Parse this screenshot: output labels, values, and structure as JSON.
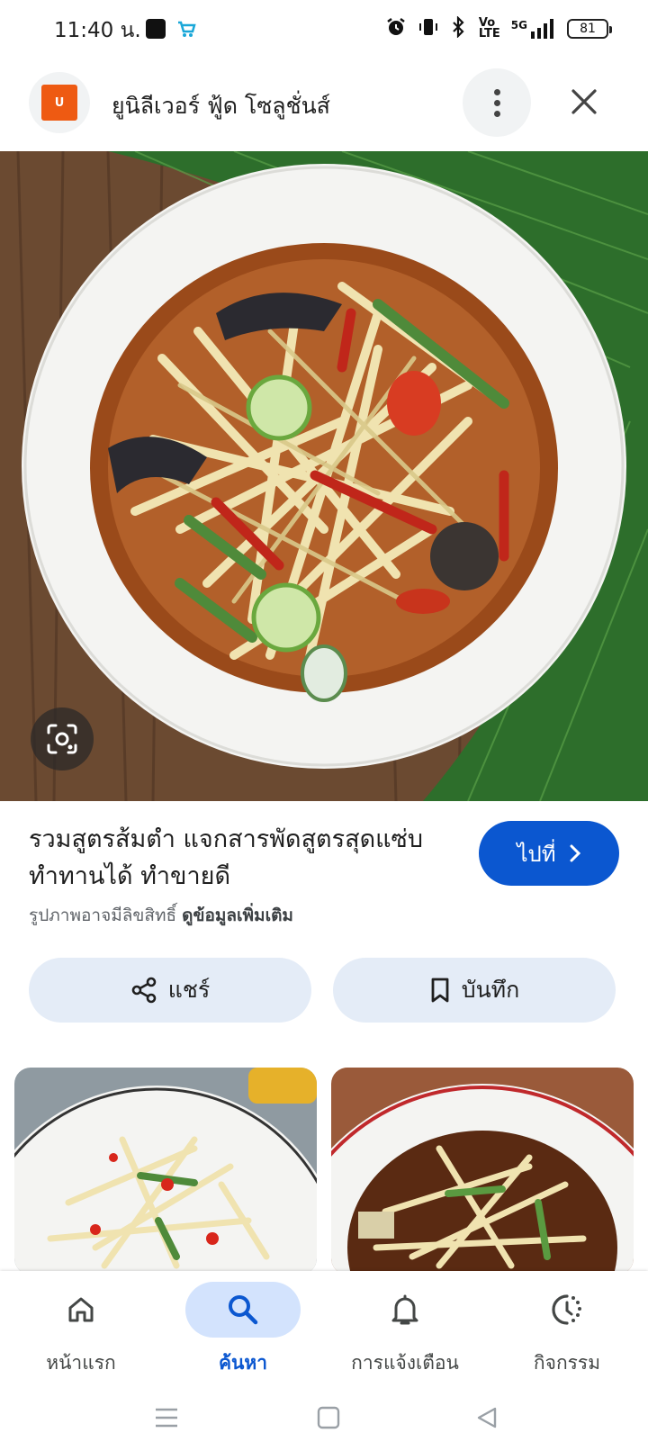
{
  "status_bar": {
    "time": "11:40 น.",
    "signal_label": "5G",
    "battery": "81"
  },
  "header": {
    "site_name": "ยูนิลีเวอร์ ฟู้ด โซลูชั่นส์",
    "logo_text": "U"
  },
  "result": {
    "title": "รวมสูตรส้มตำ แจกสารพัดสูตรสุดแซ่บ ทำทานได้ ทำขายดี",
    "visit_label": "ไปที่",
    "copyright_text": "รูปภาพอาจมีลิขสิทธิ์",
    "learn_more": "ดูข้อมูลเพิ่มเติม"
  },
  "actions": {
    "share_label": "แชร์",
    "save_label": "บันทึก"
  },
  "bottom_nav": {
    "items": [
      {
        "label": "หน้าแรก",
        "icon": "home-icon"
      },
      {
        "label": "ค้นหา",
        "icon": "search-icon",
        "active": true
      },
      {
        "label": "การแจ้งเตือน",
        "icon": "bell-icon"
      },
      {
        "label": "กิจกรรม",
        "icon": "activity-icon"
      }
    ]
  },
  "colors": {
    "accent": "#0b57d0",
    "active_pill": "#d3e3fd",
    "action_button_bg": "#e4ecf7",
    "logo_bg": "#ee5a12"
  }
}
